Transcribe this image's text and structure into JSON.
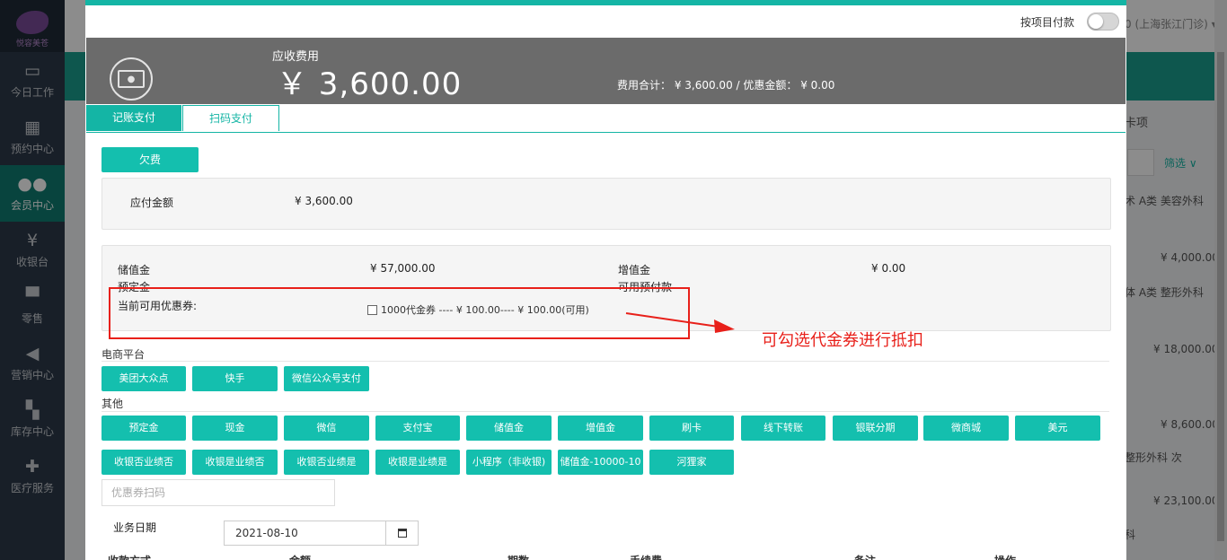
{
  "sidebar": {
    "logo_text": "悦容美苍",
    "items": [
      {
        "label": "今日工作",
        "icon": "monitor-icon"
      },
      {
        "label": "预约中心",
        "icon": "calendar-icon"
      },
      {
        "label": "会员中心",
        "icon": "users-icon",
        "active": true
      },
      {
        "label": "收银台",
        "icon": "yen-icon"
      },
      {
        "label": "零售",
        "icon": "cart-icon"
      },
      {
        "label": "营销中心",
        "icon": "megaphone-icon"
      },
      {
        "label": "库存中心",
        "icon": "grid-icon"
      },
      {
        "label": "医疗服务",
        "icon": "medkit-icon"
      }
    ]
  },
  "background": {
    "store": "0 (上海张江门诊) ▾",
    "col_label": "卡项",
    "filter": "筛选 ∨",
    "row1_tags": "术  A类  美容外科",
    "row1_amount": "¥ 4,000.00",
    "row2_tags": "体  A类  整形外科",
    "row2_amount": "¥ 18,000.00",
    "row3_amount": "¥ 8,600.00",
    "row4_tags": "整形外科    次",
    "row4_amount": "¥ 23,100.00",
    "row5_tags": "科"
  },
  "modal": {
    "pay_by_item_label": "按项目付款",
    "due_label": "应收费用",
    "due_amount": "￥ 3,600.00",
    "summary": "费用合计：  ¥ 3,600.00 / 优惠金额：  ¥ 0.00",
    "tabs": [
      "记账支付",
      "扫码支付"
    ],
    "arrears_button": "欠费",
    "payable_label": "应付金额",
    "payable_value": "¥ 3,600.00",
    "stored_label": "储值金",
    "stored_value": "¥ 57,000.00",
    "bonus_label": "增值金",
    "bonus_value": "¥ 0.00",
    "deposit_label": "预定金",
    "prepay_label": "可用预付款",
    "coupon_label": "当前可用优惠券:",
    "coupon_option": "1000代金券 ----  ¥  100.00----  ¥  100.00(可用)",
    "ecommerce_title": "电商平台",
    "ecommerce_buttons": [
      "美团大众点",
      "快手",
      "微信公众号支付"
    ],
    "other_title": "其他",
    "other_buttons_row1": [
      "预定金",
      "现金",
      "微信",
      "支付宝",
      "储值金",
      "增值金",
      "刷卡",
      "线下转账",
      "银联分期",
      "微商城",
      "美元"
    ],
    "other_buttons_row2": [
      "收银否业绩否",
      "收银是业绩否",
      "收银否业绩是",
      "收银是业绩是",
      "小程序（非收银)",
      "储值金-10000-10",
      "河狸家"
    ],
    "coupon_scan_placeholder": "优惠券扫码",
    "biz_date_label": "业务日期",
    "biz_date_value": "2021-08-10",
    "table_headers": [
      "收款方式",
      "金额",
      "期数",
      "手续费",
      "备注",
      "操作"
    ]
  },
  "annotation": {
    "text": "可勾选代金券进行抵扣",
    "color": "#e8201a"
  },
  "colors": {
    "accent": "#14bfae",
    "sidebar": "#2d3a4a",
    "banner": "#6b6b6b"
  }
}
